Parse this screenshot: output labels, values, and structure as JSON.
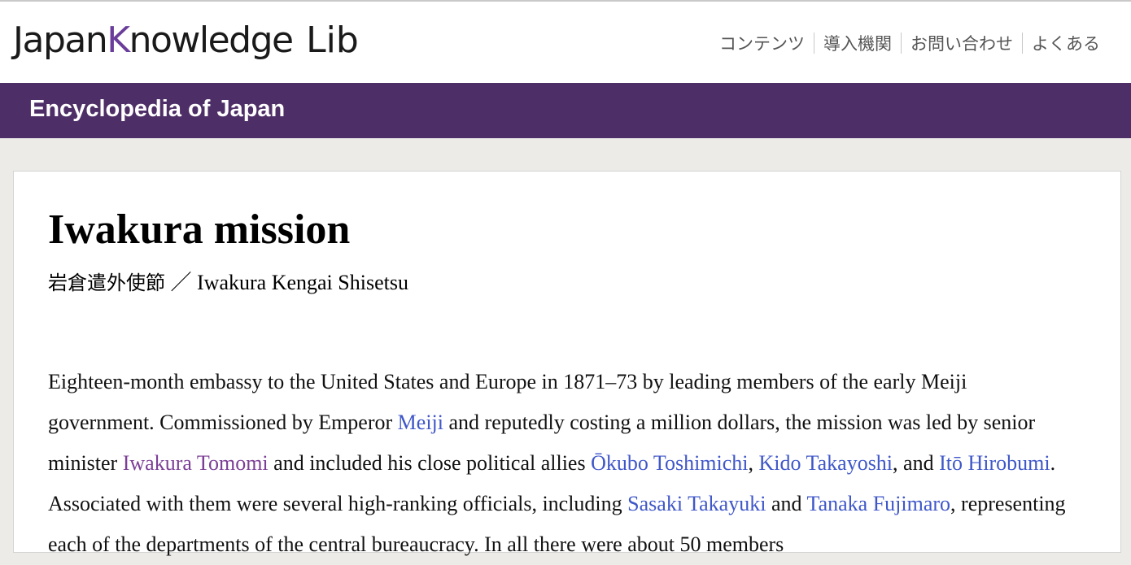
{
  "header": {
    "logo_japan": "Japan",
    "logo_k": "K",
    "logo_nowledge": "nowledge",
    "logo_lib": "Lib",
    "nav": [
      "コンテンツ",
      "導入機関",
      "お問い合わせ",
      "よくある"
    ]
  },
  "banner": {
    "title": "Encyclopedia of Japan"
  },
  "article": {
    "title": "Iwakura mission",
    "subtitle_jp": "岩倉遣外使節",
    "subtitle_sep": " ／ ",
    "subtitle_en": "Iwakura Kengai Shisetsu",
    "p1": "Eighteen-month embassy to the United States and Europe in 1871–73 by leading members of the early Meiji government. Commissioned by Emperor ",
    "link_meiji": "Meiji",
    "p2": " and reputedly costing a million dollars, the mission was led by senior minister ",
    "link_iwakura": "Iwakura Tomomi",
    "p3": " and included his close political allies ",
    "link_okubo": "Ōkubo Toshimichi",
    "p4": ", ",
    "link_kido": "Kido Takayoshi",
    "p5": ", and ",
    "link_ito": "Itō Hirobumi",
    "p6": ". Associated with them were several high-ranking officials, including ",
    "link_sasaki": "Sasaki Takayuki",
    "p7": " and ",
    "link_tanaka": "Tanaka Fujimaro",
    "p8": ", representing each of the departments of the central bureaucracy. In all there were about 50 members"
  },
  "colors": {
    "brand_purple": "#4e2e66",
    "logo_k": "#6a3d9a",
    "link": "#3f57c9",
    "visited_link": "#7c3e96"
  }
}
